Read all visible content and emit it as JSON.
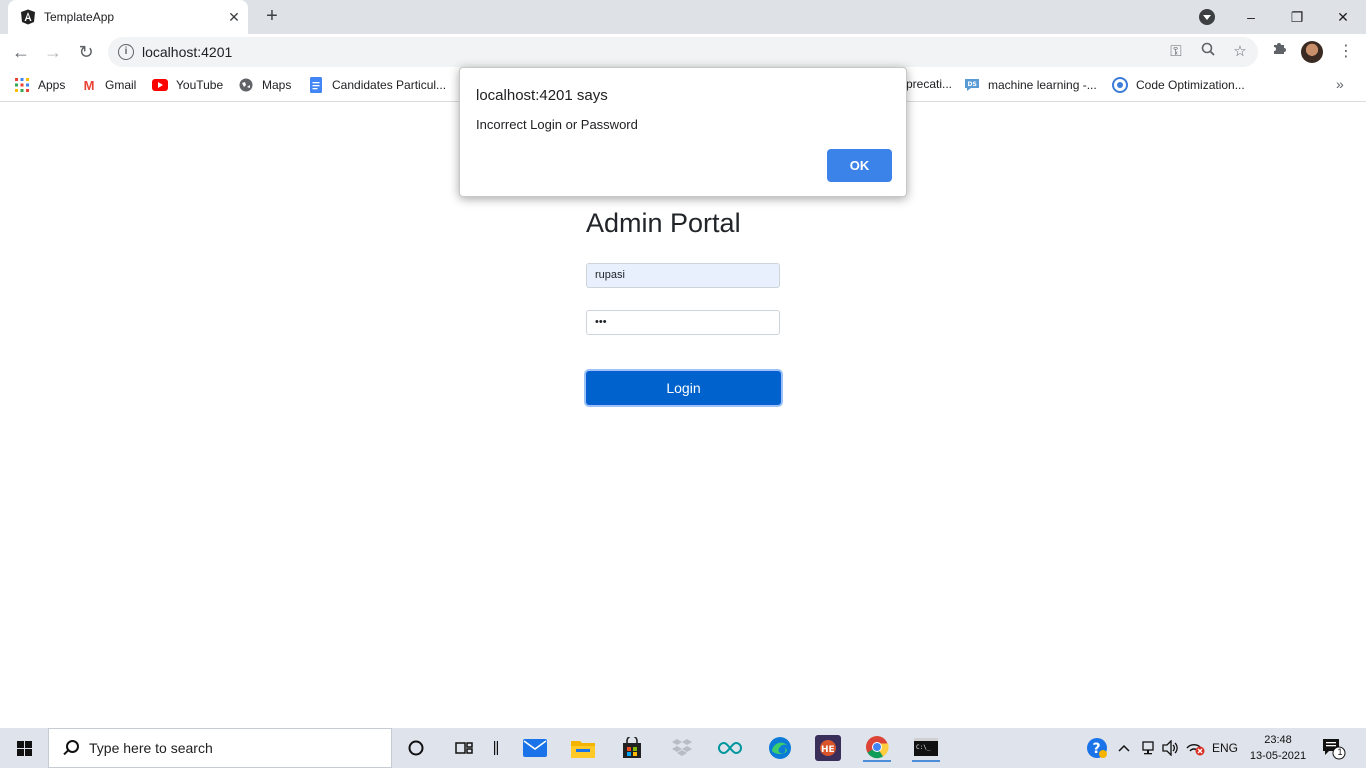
{
  "browser": {
    "tab_title": "TemplateApp",
    "tab_close": "✕",
    "new_tab": "+",
    "url": "localhost:4201",
    "bookmarks": [
      {
        "label": "Apps",
        "icon": "apps-grid-icon"
      },
      {
        "label": "Gmail",
        "icon": "gmail-icon"
      },
      {
        "label": "YouTube",
        "icon": "youtube-icon"
      },
      {
        "label": "Maps",
        "icon": "maps-icon"
      },
      {
        "label": "Candidates Particul...",
        "icon": "docs-icon"
      },
      {
        "label": "precati...",
        "icon": "bookmark-icon"
      },
      {
        "label": "machine learning -...",
        "icon": "ds-icon"
      },
      {
        "label": "Code Optimization...",
        "icon": "code-icon"
      }
    ],
    "bookmarks_overflow": "»"
  },
  "page": {
    "title": "Admin Portal",
    "username_value": "rupasi",
    "password_value": "•••",
    "login_label": "Login"
  },
  "dialog": {
    "title": "localhost:4201 says",
    "message": "Incorrect Login or Password",
    "ok_label": "OK"
  },
  "taskbar": {
    "search_placeholder": "Type here to search",
    "language": "ENG",
    "time": "23:48",
    "date": "13-05-2021",
    "notification_count": "1"
  },
  "colors": {
    "login_button": "#0062cc",
    "ok_button": "#3b82e9",
    "autofill_bg": "#e8f0fe"
  }
}
